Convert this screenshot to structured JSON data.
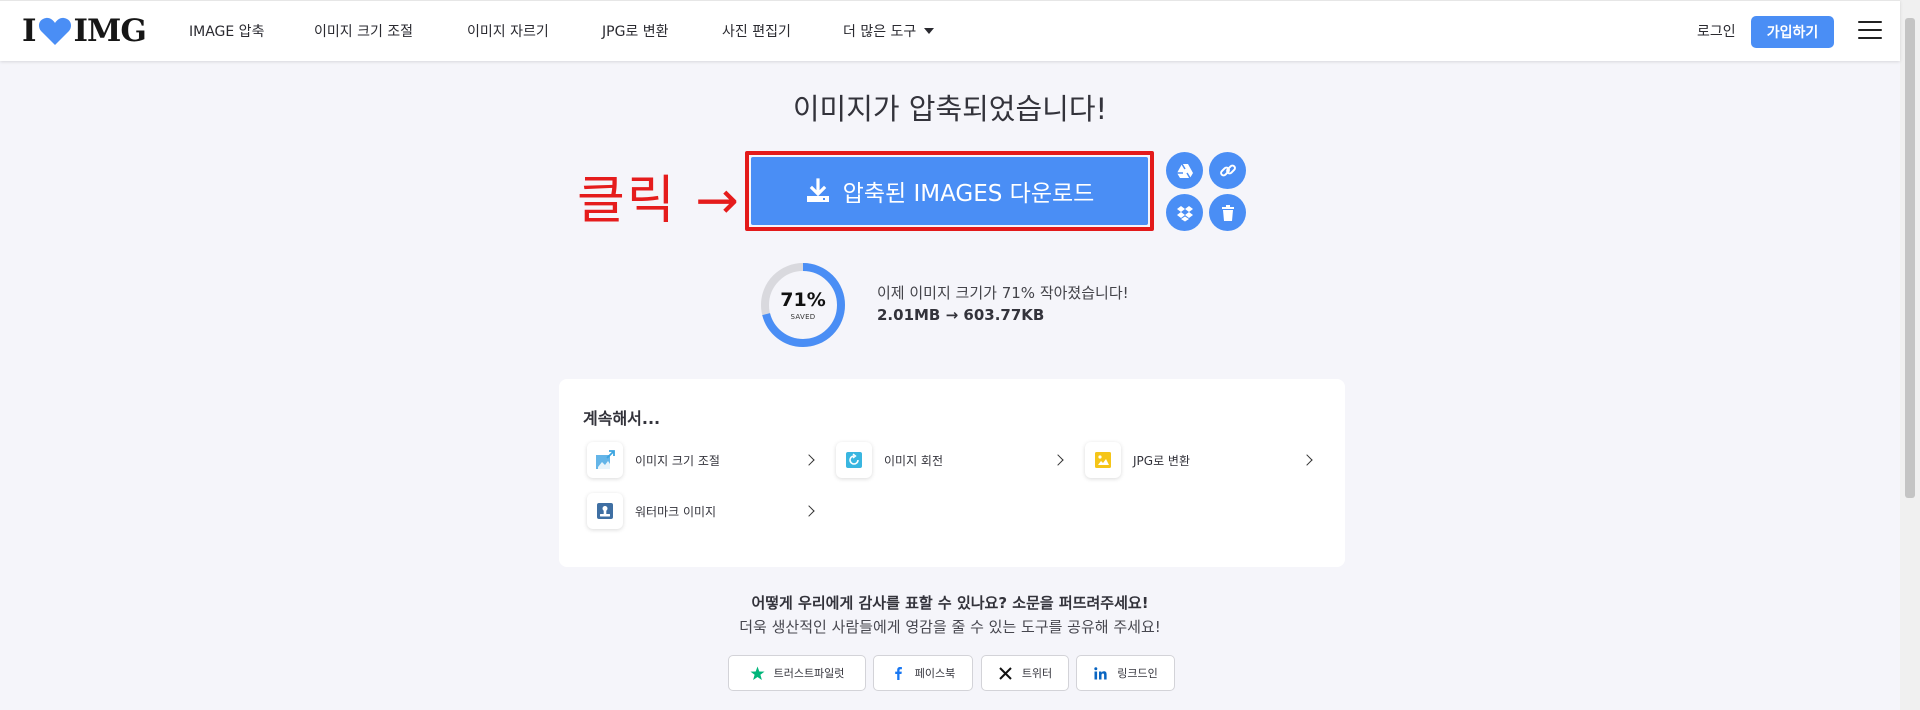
{
  "header": {
    "logo_left": "I",
    "logo_right": "IMG",
    "nav": [
      {
        "label": "IMAGE 압축"
      },
      {
        "label": "이미지 크기 조절"
      },
      {
        "label": "이미지 자르기"
      },
      {
        "label": "JPG로 변환"
      },
      {
        "label": "사진 편집기"
      },
      {
        "label": "더 많은 도구"
      }
    ],
    "login": "로그인",
    "signup": "가입하기"
  },
  "main": {
    "title": "이미지가 압축되었습니다!",
    "click_annotation": "클릭 →",
    "download_label": "압축된 IMAGES 다운로드",
    "percent": "71%",
    "percent_sub": "SAVED",
    "saved_fraction": 0.71,
    "saved_message": "이제 이미지 크기가 71% 작아졌습니다!",
    "size_change": "2.01MB → 603.77KB"
  },
  "continue": {
    "title": "계속해서...",
    "tools": [
      {
        "label": "이미지 크기 조절",
        "icon": "resize-icon"
      },
      {
        "label": "이미지 회전",
        "icon": "rotate-icon"
      },
      {
        "label": "JPG로 변환",
        "icon": "jpg-icon"
      },
      {
        "label": "워터마크 이미지",
        "icon": "watermark-icon"
      }
    ]
  },
  "share": {
    "title": "어떻게 우리에게 감사를 표할 수 있나요? 소문을 퍼뜨려주세요!",
    "subtitle": "더욱 생산적인 사람들에게 영감을 줄 수 있는 도구를 공유해 주세요!",
    "buttons": [
      {
        "label": "트러스트파일럿",
        "icon": "star-icon"
      },
      {
        "label": "페이스북",
        "icon": "facebook-icon"
      },
      {
        "label": "트위터",
        "icon": "x-icon"
      },
      {
        "label": "링크드인",
        "icon": "linkedin-icon"
      }
    ]
  },
  "colors": {
    "accent": "#4a8ef5",
    "annotation": "#e31a1a",
    "background": "#f5f5fa"
  }
}
